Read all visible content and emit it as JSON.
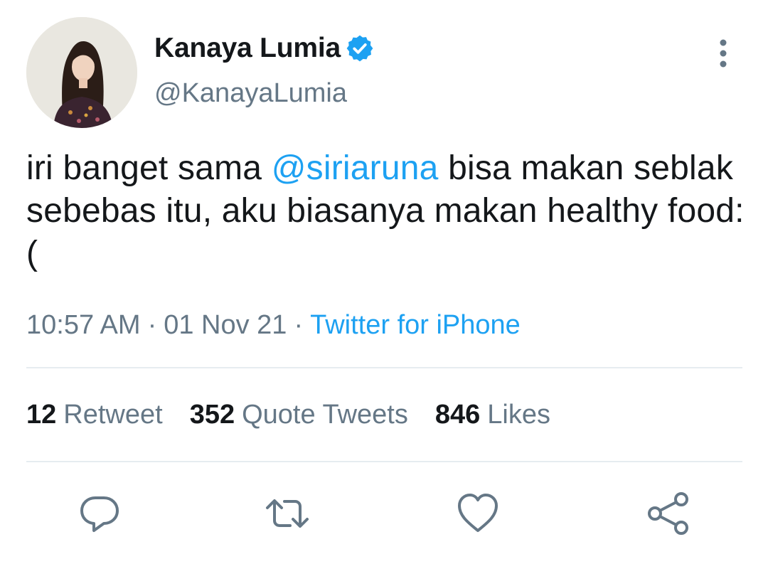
{
  "author": {
    "display_name": "Kanaya Lumia",
    "handle": "@KanayaLumia"
  },
  "tweet": {
    "text_before": "iri banget sama ",
    "mention": "@siriaruna",
    "text_after": " bisa makan seblak sebebas itu, aku biasanya makan healthy food:("
  },
  "meta": {
    "time": "10:57 AM",
    "separator": "·",
    "date": "01 Nov 21",
    "source": "Twitter for iPhone"
  },
  "stats": {
    "retweets": {
      "count": "12",
      "label": "Retweet"
    },
    "quotes": {
      "count": "352",
      "label": "Quote Tweets"
    },
    "likes": {
      "count": "846",
      "label": "Likes"
    }
  },
  "icons": {
    "verified": "verified-badge-icon",
    "more": "more-vertical-icon",
    "reply": "reply-icon",
    "retweet": "retweet-icon",
    "like": "like-icon",
    "share": "share-icon"
  },
  "colors": {
    "accent": "#1da1f2",
    "text": "#14171a",
    "secondary": "#657786",
    "divider": "#e6ecf0"
  }
}
